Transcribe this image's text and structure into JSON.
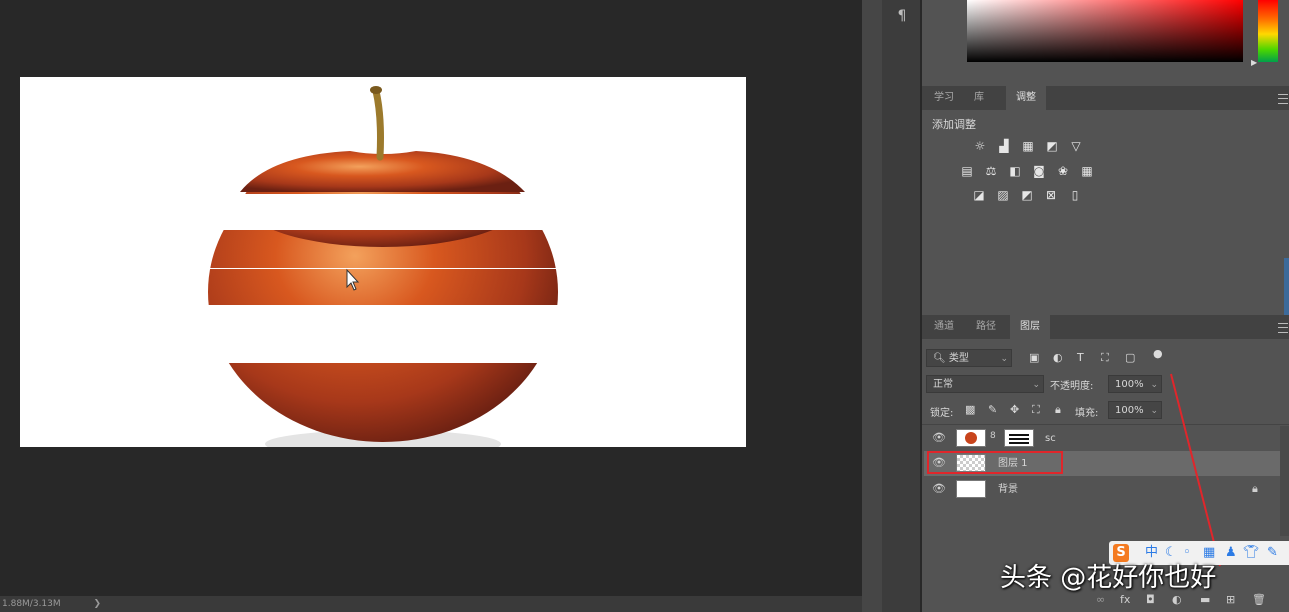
{
  "status": {
    "doc_size": "1.88M/3.13M",
    "arrow": "❯"
  },
  "tools": {
    "paragraph": "¶"
  },
  "adjust_panel": {
    "tabs": [
      "学习",
      "库",
      "调整"
    ],
    "active_tab": "调整",
    "title": "添加调整",
    "row1": [
      "brightness-contrast-icon",
      "levels-icon",
      "curves-icon",
      "exposure-icon",
      "vibrance-icon"
    ],
    "row2": [
      "hue-saturation-icon",
      "color-balance-icon",
      "black-white-icon",
      "photo-filter-icon",
      "channel-mixer-icon",
      "color-lookup-icon"
    ],
    "row3": [
      "invert-icon",
      "posterize-icon",
      "threshold-icon",
      "selective-color-icon",
      "gradient-map-icon"
    ]
  },
  "layers_panel": {
    "tabs": [
      "通道",
      "路径",
      "图层"
    ],
    "active_tab": "图层",
    "filter_label": "类型",
    "blend_mode": "正常",
    "opacity_label": "不透明度:",
    "opacity_value": "100%",
    "lock_label": "锁定:",
    "fill_label": "填充:",
    "fill_value": "100%",
    "layers": [
      {
        "name": "sc",
        "visible": true,
        "selected": false
      },
      {
        "name": "图层 1",
        "visible": true,
        "selected": true
      },
      {
        "name": "背景",
        "visible": true,
        "selected": false,
        "locked": true
      }
    ]
  },
  "watermark": "头条 @花好你也好",
  "ime_toolbar": {
    "label_s": "S",
    "label_zh": "中"
  },
  "colors": {
    "accent_red": "#e0262b",
    "panel_bg": "#535353",
    "canvas_bg": "#282828",
    "selected_row": "#6a6a6a"
  }
}
